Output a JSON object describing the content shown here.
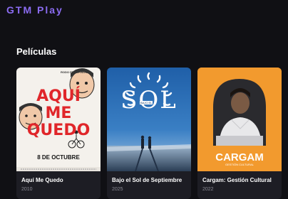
{
  "app": {
    "logo": "GTM Play"
  },
  "section": {
    "title": "Películas"
  },
  "movies": [
    {
      "title": "Aquí Me Quedo",
      "year": "2010",
      "poster": {
        "line1": "AQUÍ",
        "line2": "ME",
        "line3": "QUEDO",
        "date": "8 DE OCTUBRE",
        "credit": "RODO FE ESPINOSA"
      }
    },
    {
      "title": "Bajo el Sol de Septiembre",
      "year": "2025",
      "poster": {
        "word": "SOL",
        "small": "BAJO EL"
      }
    },
    {
      "title": "Cargam: Gestión Cultural",
      "year": "2022",
      "poster": {
        "word": "CARGAM",
        "sub": "GESTIÓN CULTURAL"
      }
    }
  ],
  "colors": {
    "accent": "#8b6cf2",
    "background": "#101014",
    "card": "#1d1d24"
  }
}
